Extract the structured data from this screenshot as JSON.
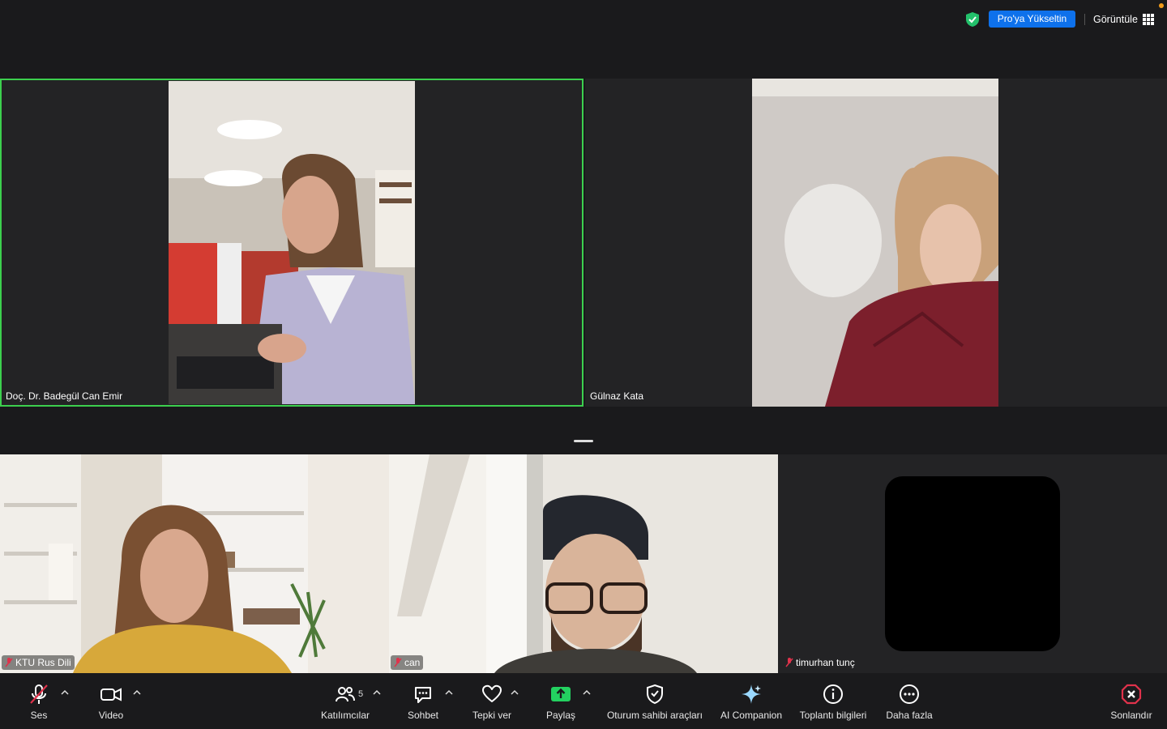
{
  "topbar": {
    "upgrade_label": "Pro'ya Yükseltin",
    "view_label": "Görüntüle"
  },
  "participants": [
    {
      "name": "Doç. Dr. Badegül Can Emir",
      "muted": false,
      "speaking": true
    },
    {
      "name": "Gülnaz Kata",
      "muted": false,
      "speaking": false
    },
    {
      "name": "KTU Rus Dili",
      "muted": true,
      "speaking": false
    },
    {
      "name": "can",
      "muted": true,
      "speaking": false
    },
    {
      "name": "timurhan tunç",
      "muted": true,
      "speaking": false
    }
  ],
  "toolbar": {
    "audio_label": "Ses",
    "video_label": "Video",
    "participants_label": "Katılımcılar",
    "participants_count": "5",
    "chat_label": "Sohbet",
    "react_label": "Tepki ver",
    "share_label": "Paylaş",
    "host_tools_label": "Oturum sahibi araçları",
    "ai_companion_label": "AI Companion",
    "meeting_info_label": "Toplantı bilgileri",
    "more_label": "Daha fazla",
    "end_label": "Sonlandır"
  },
  "colors": {
    "active_speaker": "#3ccf4e",
    "upgrade_button": "#0e71eb",
    "share_green": "#23d160",
    "end_red": "#e0324b",
    "mute_red": "#e0324b"
  }
}
